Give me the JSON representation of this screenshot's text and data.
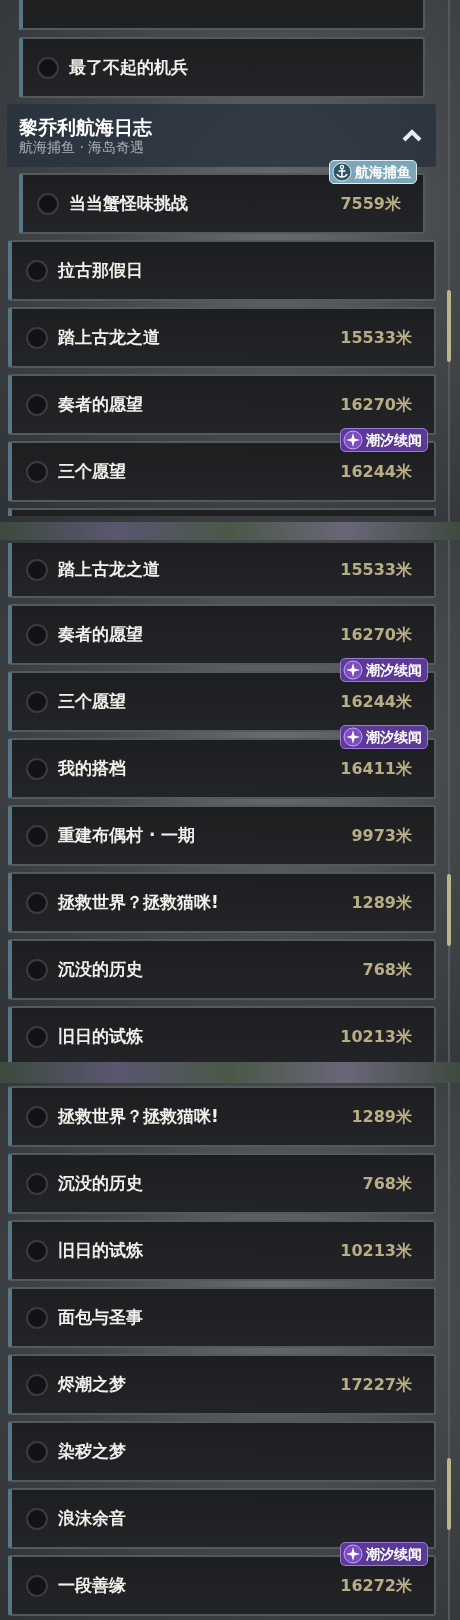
{
  "panels": [
    {
      "items": [
        {
          "kind": "cut",
          "indented": true,
          "cut_top": true
        },
        {
          "kind": "task",
          "indented": true,
          "checked": false,
          "name": "最了不起的机兵"
        },
        {
          "kind": "header",
          "title": "黎乔利航海日志",
          "subtitle": "航海捕鱼 · 海岛奇遇",
          "expanded": true
        },
        {
          "kind": "task",
          "indented": true,
          "checked": false,
          "name": "当当蟹怪味挑战",
          "distance": "7559米",
          "badge": {
            "kind": "voyage",
            "label": "航海捕鱼"
          }
        },
        {
          "kind": "task",
          "indented": false,
          "checked": false,
          "name": "拉古那假日"
        },
        {
          "kind": "task",
          "indented": false,
          "checked": false,
          "name": "踏上古龙之道",
          "distance": "15533米"
        },
        {
          "kind": "task",
          "indented": false,
          "checked": false,
          "name": "奏者的愿望",
          "distance": "16270米"
        },
        {
          "kind": "task",
          "indented": false,
          "checked": false,
          "name": "三个愿望",
          "distance": "16244米",
          "badge": {
            "kind": "tide",
            "label": "潮汐续闻"
          }
        },
        {
          "kind": "cut",
          "indented": false,
          "cut_top": false
        }
      ]
    },
    {
      "items": [
        {
          "kind": "task",
          "indented": false,
          "checked": false,
          "name": "踏上古龙之道",
          "distance": "15533米",
          "cut_top": true
        },
        {
          "kind": "task",
          "indented": false,
          "checked": false,
          "name": "奏者的愿望",
          "distance": "16270米"
        },
        {
          "kind": "task",
          "indented": false,
          "checked": false,
          "name": "三个愿望",
          "distance": "16244米",
          "badge": {
            "kind": "tide",
            "label": "潮汐续闻"
          }
        },
        {
          "kind": "task",
          "indented": false,
          "checked": false,
          "name": "我的搭档",
          "distance": "16411米",
          "badge": {
            "kind": "tide",
            "label": "潮汐续闻"
          }
        },
        {
          "kind": "task",
          "indented": false,
          "checked": false,
          "name": "重建布偶村 · 一期",
          "distance": "9973米"
        },
        {
          "kind": "task",
          "indented": false,
          "checked": false,
          "name": "拯救世界？拯救猫咪!",
          "distance": "1289米"
        },
        {
          "kind": "task",
          "indented": false,
          "checked": false,
          "name": "沉没的历史",
          "distance": "768米"
        },
        {
          "kind": "task",
          "indented": false,
          "checked": false,
          "name": "旧日的试炼",
          "distance": "10213米"
        }
      ]
    },
    {
      "items": [
        {
          "kind": "task",
          "indented": false,
          "checked": false,
          "name": "拯救世界？拯救猫咪!",
          "distance": "1289米"
        },
        {
          "kind": "task",
          "indented": false,
          "checked": false,
          "name": "沉没的历史",
          "distance": "768米"
        },
        {
          "kind": "task",
          "indented": false,
          "checked": false,
          "name": "旧日的试炼",
          "distance": "10213米"
        },
        {
          "kind": "task",
          "indented": false,
          "checked": false,
          "name": "面包与圣事"
        },
        {
          "kind": "task",
          "indented": false,
          "checked": false,
          "name": "烬潮之梦",
          "distance": "17227米"
        },
        {
          "kind": "task",
          "indented": false,
          "checked": false,
          "name": "染秽之梦"
        },
        {
          "kind": "task",
          "indented": false,
          "checked": false,
          "name": "浪沫余音"
        },
        {
          "kind": "task",
          "indented": false,
          "checked": false,
          "name": "一段善缘",
          "distance": "16272米",
          "badge": {
            "kind": "tide",
            "label": "潮汐续闻"
          }
        }
      ]
    }
  ]
}
